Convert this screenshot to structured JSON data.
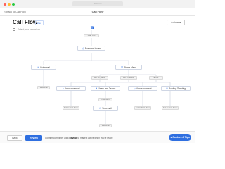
{
  "browser": {
    "url": "zoom.us"
  },
  "topbar": {
    "back_label": "< Back to Call Flow",
    "center_title": "Call Flow"
  },
  "header": {
    "title": "Call Flow",
    "edit_label": "Edit",
    "checkbox_label": "Select your extensions",
    "actions_label": "Actions"
  },
  "flow": {
    "start_label": "Start Call",
    "business_hours": "Business Hours",
    "voicemail_left": "Voicemail",
    "phone_menu": "Phone Menu",
    "voicemail_left_pill": "Voicemail",
    "phone_menu_pill_1": "Ext: 1 (Sales)",
    "phone_menu_pill_2": "Ext: 2 (Sales)",
    "phone_menu_pill_3": "Ext: 3",
    "announcement_1": "Announcement",
    "users_and_teams": "Users and Teams",
    "announcement_2": "Announcement",
    "routing_greeting": "Routing Greeting",
    "announcement_1_pill": "Ask to Start Menu",
    "users_and_teams_pill": "Last Start",
    "announcement_2_pill": "Ask to Start Menu",
    "routing_greeting_pill": "Ask to Start Menu",
    "voicemail_bottom": "Voicemail",
    "voicemail_bottom_pill": "Voicemail"
  },
  "footer": {
    "back_label": "Back",
    "review_label": "Review",
    "note_prefix": "Confirm complete. Click",
    "note_bold": "Review",
    "note_suffix": "to make it active when you're ready.",
    "cookies_label": "Cookies & Tips"
  },
  "colors": {
    "accent": "#2f6fe0",
    "line": "#c8ced9"
  }
}
